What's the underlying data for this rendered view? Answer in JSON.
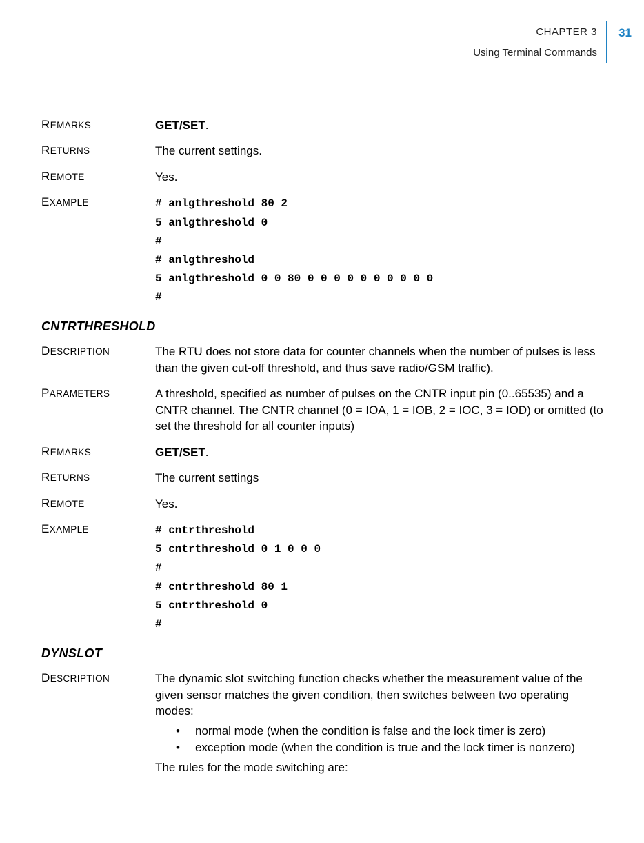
{
  "header": {
    "page_number": "31",
    "chapter": "CHAPTER 3",
    "breadcrumb": "Using Terminal Commands"
  },
  "section1": {
    "remarks_label": "REMARKS",
    "remarks_value": "GET/SET",
    "remarks_suffix": ".",
    "returns_label": "RETURNS",
    "returns_value": "The current settings.",
    "remote_label": "REMOTE",
    "remote_value": "Yes.",
    "example_label": "EXAMPLE",
    "example_lines": [
      "# anlgthreshold 80 2",
      "5 anlgthreshold 0",
      "#",
      "# anlgthreshold",
      "5 anlgthreshold 0 0 80 0 0 0 0 0 0 0 0 0 0",
      "#"
    ]
  },
  "section2": {
    "title": "CNTRTHRESHOLD",
    "description_label": "DESCRIPTION",
    "description_value": "The RTU does not store data for counter channels when the number of pulses is less than the given cut-off threshold, and thus save radio/GSM traffic).",
    "parameters_label": "PARAMETERS",
    "parameters_value": "A threshold, specified as number of pulses on the CNTR input pin (0..65535) and a CNTR channel. The CNTR channel (0 = IOA, 1 = IOB, 2 = IOC, 3 = IOD) or omitted (to set the threshold for all counter inputs)",
    "remarks_label": "REMARKS",
    "remarks_value": "GET/SET",
    "remarks_suffix": ".",
    "returns_label": "RETURNS",
    "returns_value": "The current settings",
    "remote_label": "REMOTE",
    "remote_value": "Yes.",
    "example_label": "EXAMPLE",
    "example_lines": [
      "# cntrthreshold",
      "5 cntrthreshold 0 1 0 0 0",
      "#",
      "# cntrthreshold 80 1",
      "5 cntrthreshold 0",
      "#"
    ]
  },
  "section3": {
    "title": "DYNSLOT",
    "description_label": "DESCRIPTION",
    "description_value": "The dynamic slot switching function checks whether the measurement value of the given sensor matches the given condition, then switches between two operating modes:",
    "bullets": [
      "normal mode (when the condition is false and the lock timer is zero)",
      "exception mode (when the condition is true and the lock timer is nonzero)"
    ],
    "closing": "The rules for the mode switching are:"
  }
}
